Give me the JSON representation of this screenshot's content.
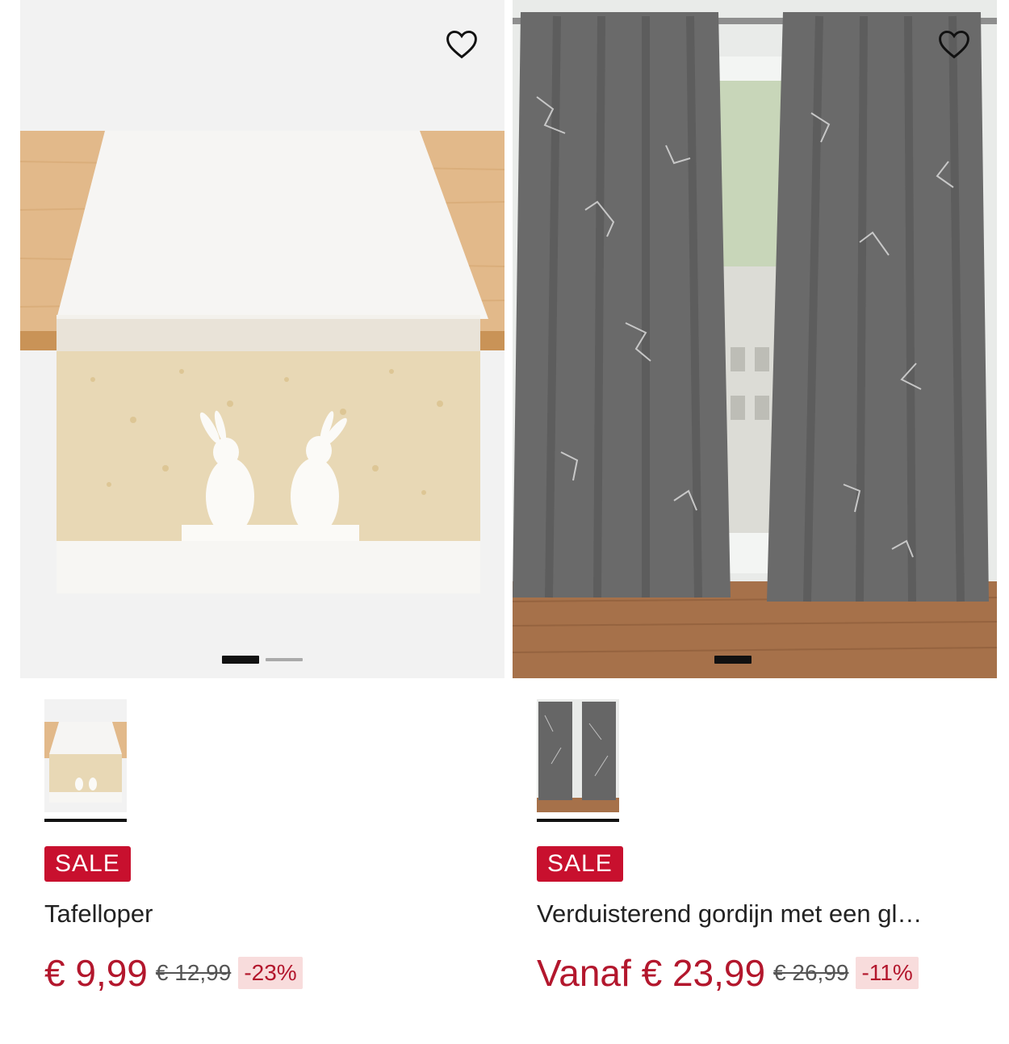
{
  "products": [
    {
      "title": "Tafelloper",
      "sale_badge": "SALE",
      "price": "€ 9,99",
      "old_price": "€ 12,99",
      "discount": "-23%",
      "wishlist_icon": "heart-outline-icon",
      "image_slides": 2,
      "active_slide": 1
    },
    {
      "title": "Verduisterend gordijn met een gl…",
      "sale_badge": "SALE",
      "price": "Vanaf € 23,99",
      "old_price": "€ 26,99",
      "discount": "-11%",
      "wishlist_icon": "heart-outline-icon",
      "image_slides": 1,
      "active_slide": 1
    }
  ],
  "colors": {
    "sale_red": "#c8102e",
    "price_red": "#b3172d",
    "discount_bg": "#f8dcdc"
  }
}
